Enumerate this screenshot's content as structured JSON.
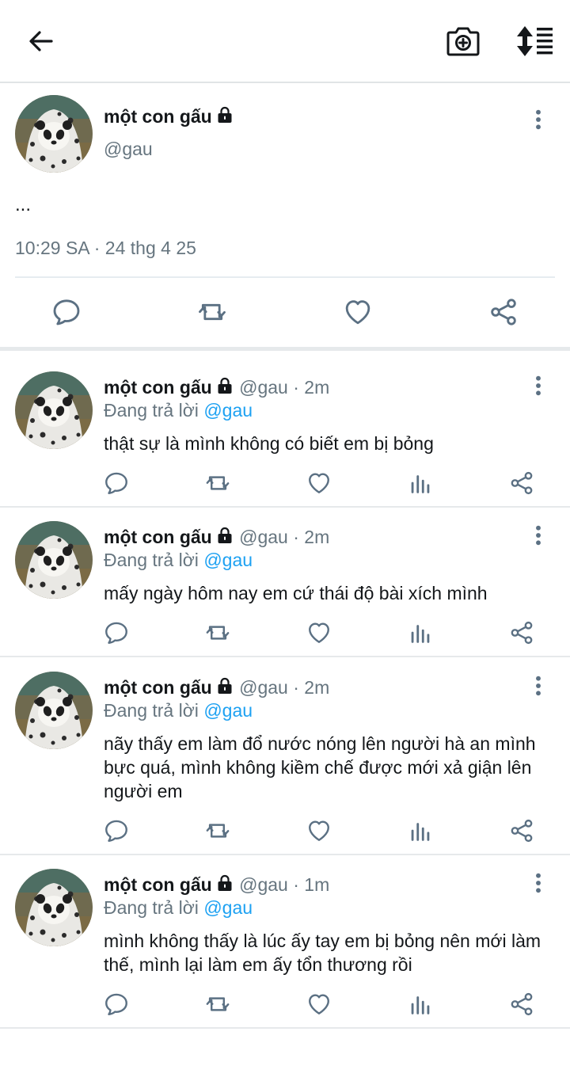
{
  "header": {
    "back_icon": "arrow-left-icon",
    "camera_icon": "camera-add-icon",
    "sort_icon": "sort-icon"
  },
  "main_tweet": {
    "author_name": "một con gấu",
    "handle": "@gau",
    "body": "...",
    "timestamp": "10:29 SA · 24 thg 4 25"
  },
  "replies": [
    {
      "author_name": "một con gấu",
      "handle": "@gau",
      "time": " · 2m",
      "replying_prefix": "Đang trả lời ",
      "replying_to": "@gau",
      "text": "thật sự là mình không có biết em bị bỏng"
    },
    {
      "author_name": "một con gấu",
      "handle": "@gau",
      "time": " · 2m",
      "replying_prefix": "Đang trả lời ",
      "replying_to": "@gau",
      "text": "mấy ngày hôm nay em cứ thái độ bài xích mình"
    },
    {
      "author_name": "một con gấu",
      "handle": "@gau",
      "time": " · 2m",
      "replying_prefix": "Đang trả lời ",
      "replying_to": "@gau",
      "text": "nãy thấy em làm đổ nước nóng lên người hà an mình bực quá, mình không kiềm chế được mới xả giận lên người em"
    },
    {
      "author_name": "một con gấu",
      "handle": "@gau",
      "time": " · 1m",
      "replying_prefix": "Đang trả lời ",
      "replying_to": "@gau",
      "text": "mình không thấy là lúc ấy tay em bị bỏng nên mới làm thế, mình lại làm em ấy tổn thương rồi"
    }
  ],
  "colors": {
    "text": "#14171a",
    "secondary": "#66757f",
    "link": "#1da1f2",
    "icon": "#5b7083"
  }
}
